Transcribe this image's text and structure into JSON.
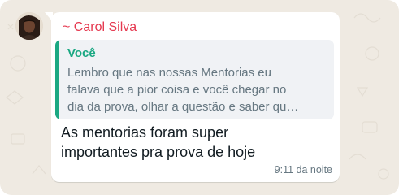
{
  "colors": {
    "wallpaper": "#efeae2",
    "bubble": "#ffffff",
    "sender_name": "#e5384f",
    "quote_accent": "#1aa882",
    "quote_background": "#f0f2f5",
    "quote_text": "#667781",
    "message_text": "#111b21",
    "timestamp": "#667781"
  },
  "message": {
    "sender": "~ Carol Silva",
    "avatar": "contact-avatar-photo",
    "quote": {
      "author": "Você",
      "lines": [
        "Lembro que nas nossas Mentorias eu",
        "falava que a pior coisa e você chegar no",
        "dia da prova, olhar a questão e saber qu…"
      ]
    },
    "text_lines": [
      "As mentorias foram super",
      "importantes pra prova de hoje"
    ],
    "timestamp": "9:11 da noite"
  }
}
